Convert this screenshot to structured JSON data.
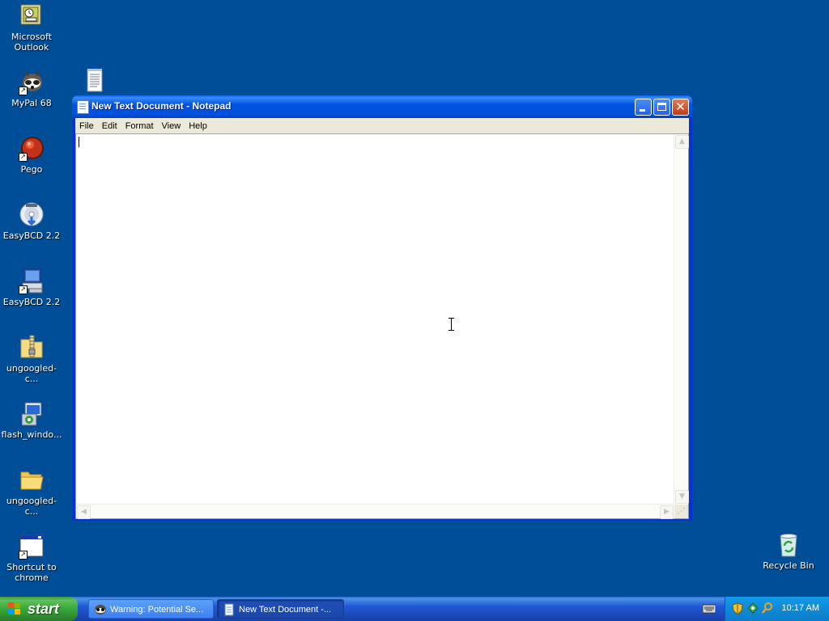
{
  "desktop": {
    "icons": [
      {
        "label": "Microsoft Outlook",
        "icon": "outlook-icon"
      },
      {
        "label": "MyPal 68",
        "icon": "mypal-icon"
      },
      {
        "label": "Pego",
        "icon": "pego-icon"
      },
      {
        "label": "EasyBCD 2.2",
        "icon": "easybcd-installer-icon"
      },
      {
        "label": "EasyBCD 2.2",
        "icon": "easybcd-shortcut-icon"
      },
      {
        "label": "ungoogled-c...",
        "icon": "zip-folder-icon"
      },
      {
        "label": "flash_windo...",
        "icon": "installer-icon"
      },
      {
        "label": "ungoogled-c...",
        "icon": "folder-icon"
      },
      {
        "label": "Shortcut to chrome",
        "icon": "window-shortcut-icon"
      },
      {
        "label": "Recycle Bin",
        "icon": "recycle-bin-icon"
      }
    ]
  },
  "notepad": {
    "title": "New Text Document - Notepad",
    "menu": [
      "File",
      "Edit",
      "Format",
      "View",
      "Help"
    ],
    "content": ""
  },
  "taskbar": {
    "start_label": "start",
    "tasks": [
      {
        "label": "Warning: Potential Se...",
        "active": false
      },
      {
        "label": "New Text Document -...",
        "active": true
      }
    ],
    "clock": "10:17 AM"
  }
}
